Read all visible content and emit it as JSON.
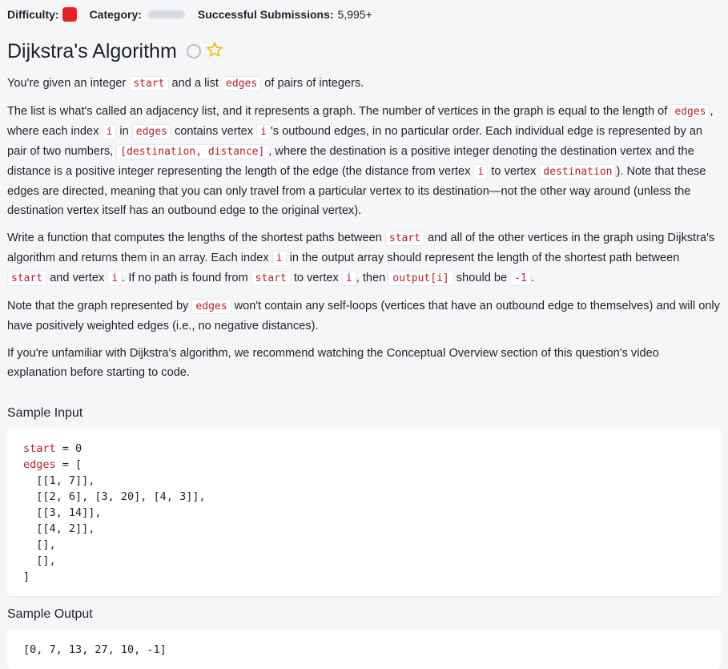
{
  "meta": {
    "difficulty_label": "Difficulty:",
    "difficulty_color": "#ea1f24",
    "category_label": "Category:",
    "submissions_label": "Successful Submissions:",
    "submissions_value": "5,995+"
  },
  "title": "Dijkstra's Algorithm",
  "icons": {
    "completion": "circle-icon",
    "favorite": "star-icon"
  },
  "description": {
    "p1": {
      "a": "You're given an integer ",
      "c1": "start",
      "b": " and a list ",
      "c2": "edges",
      "d": " of pairs of integers."
    },
    "p2": {
      "a": "The list is what's called an adjacency list, and it represents a graph. The number of vertices in the graph is equal to the length of ",
      "c1": "edges",
      "b": ", where each index ",
      "c2": "i",
      "d": " in ",
      "c3": "edges",
      "e": " contains vertex ",
      "c4": "i",
      "f": "'s outbound edges, in no particular order. Each individual edge is represented by an pair of two numbers, ",
      "c5": "[destination, distance]",
      "g": ", where the destination is a positive integer denoting the destination vertex and the distance is a positive integer representing the length of the edge (the distance from vertex ",
      "c6": "i",
      "h": " to vertex ",
      "c7": "destination",
      "j": "). Note that these edges are directed, meaning that you can only travel from a particular vertex to its destination—not the other way around (unless the destination vertex itself has an outbound edge to the original vertex)."
    },
    "p3": {
      "a": "Write a function that computes the lengths of the shortest paths between ",
      "c1": "start",
      "b": " and all of the other vertices in the graph using Dijkstra's algorithm and returns them in an array. Each index ",
      "c2": "i",
      "d": " in the output array should represent the length of the shortest path between ",
      "c3": "start",
      "e": " and vertex ",
      "c4": "i",
      "f": ". If no path is found from ",
      "c5": "start",
      "g": " to vertex ",
      "c6": "i",
      "h": ", then ",
      "c7": "output[i]",
      "j": " should be ",
      "c8": "-1",
      "k": "."
    },
    "p4": {
      "a": "Note that the graph represented by ",
      "c1": "edges",
      "b": " won't contain any self-loops (vertices that have an outbound edge to themselves) and will only have positively weighted edges (i.e., no negative distances)."
    },
    "p5": "If you're unfamiliar with Dijkstra's algorithm, we recommend watching the Conceptual Overview section of this question's video explanation before starting to code."
  },
  "sample_input": {
    "title": "Sample Input",
    "start_var": "start",
    "start_rest": " = 0",
    "edges_var": "edges",
    "edges_rest": " = [",
    "lines": [
      "  [[1, 7]],",
      "  [[2, 6], [3, 20], [4, 3]],",
      "  [[3, 14]],",
      "  [[4, 2]],",
      "  [],",
      "  [],"
    ],
    "close": "]"
  },
  "sample_output": {
    "title": "Sample Output",
    "value": "[0, 7, 13, 27, 10, -1]"
  }
}
